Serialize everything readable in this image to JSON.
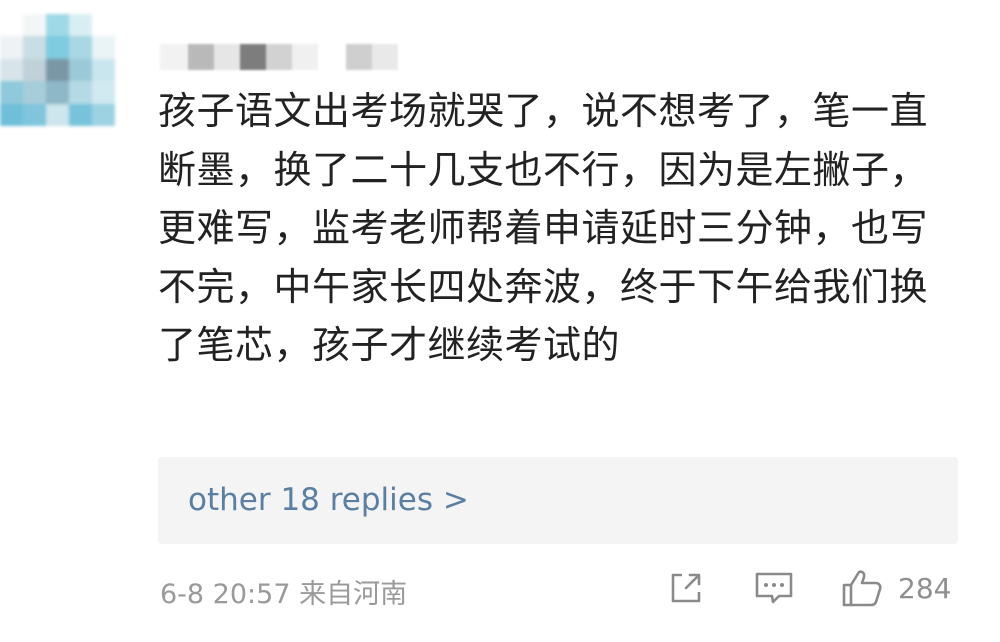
{
  "comment": {
    "text": "孩子语文出考场就哭了，说不想考了，笔一直断墨，换了二十几支也不行，因为是左撇子，更难写，监考老师帮着申请延时三分钟，也写不完，中午家长四处奔波，终于下午给我们换了笔芯，孩子才继续考试的",
    "replies_label": "other 18 replies >",
    "timestamp": "6-8 20:57",
    "location": "来自河南",
    "like_count": "284"
  },
  "icons": {
    "share": "share-icon",
    "reply": "comment-icon",
    "like": "thumbs-up-icon"
  },
  "colors": {
    "text": "#222222",
    "link": "#5b7ea3",
    "meta": "#9a9a9a",
    "reply_bg": "#f4f4f4"
  }
}
